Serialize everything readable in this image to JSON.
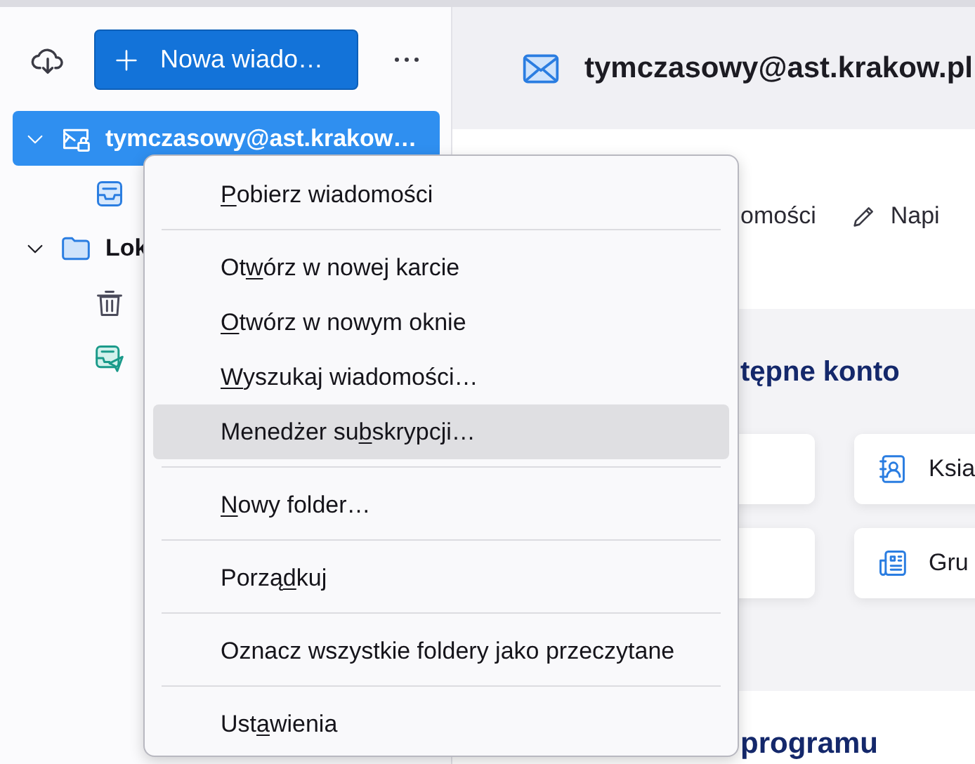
{
  "sidebar": {
    "new_message_button": {
      "label": "Nowa wiado…"
    },
    "folders": [
      {
        "kind": "account",
        "label": "tymczasowy@ast.krakow…",
        "selected": true,
        "expanded": true,
        "children": [
          {
            "kind": "inbox",
            "selected": false
          }
        ]
      },
      {
        "kind": "local",
        "label": "Lok",
        "selected": false,
        "expanded": true,
        "children": [
          {
            "kind": "trash",
            "selected": false
          },
          {
            "kind": "outbox",
            "selected": false
          }
        ]
      }
    ]
  },
  "main": {
    "account_header": {
      "title": "tymczasowy@ast.krakow.pl"
    },
    "actions": [
      {
        "kind": "get",
        "label": "omości"
      },
      {
        "kind": "write",
        "label": "Napi"
      }
    ],
    "setup_section": {
      "heading": "tępne konto",
      "cards": [
        {
          "kind": "covered"
        },
        {
          "kind": "address-book",
          "label": "Ksia"
        },
        {
          "kind": "covered"
        },
        {
          "kind": "newsgroup",
          "label": "Gru"
        }
      ]
    },
    "import_section": {
      "heading": "programu"
    }
  },
  "context_menu": {
    "items": [
      {
        "kind": "item",
        "accesskey": "P",
        "label_after": "obierz wiadomości",
        "selected": false
      },
      {
        "kind": "separator"
      },
      {
        "kind": "item",
        "label_before": "Ot",
        "accesskey": "w",
        "label_after": "órz w nowej karcie",
        "selected": false
      },
      {
        "kind": "item",
        "accesskey": "O",
        "label_after": "twórz w nowym oknie",
        "selected": false
      },
      {
        "kind": "item",
        "accesskey": "W",
        "label_after": "yszukaj wiadomości…",
        "selected": false
      },
      {
        "kind": "item",
        "label_before": "Menedżer su",
        "accesskey": "b",
        "label_after": "skrypcji…",
        "selected": true
      },
      {
        "kind": "separator"
      },
      {
        "kind": "item",
        "accesskey": "N",
        "label_after": "owy folder…",
        "selected": false
      },
      {
        "kind": "separator"
      },
      {
        "kind": "item",
        "label_before": "Porzą",
        "accesskey": "d",
        "label_after": "kuj",
        "selected": false
      },
      {
        "kind": "separator"
      },
      {
        "kind": "item",
        "label": "Oznacz wszystkie foldery jako przeczytane",
        "selected": false
      },
      {
        "kind": "separator"
      },
      {
        "kind": "item",
        "label_before": "Ust",
        "accesskey": "a",
        "label_after": "wienia",
        "selected": false
      }
    ]
  }
}
